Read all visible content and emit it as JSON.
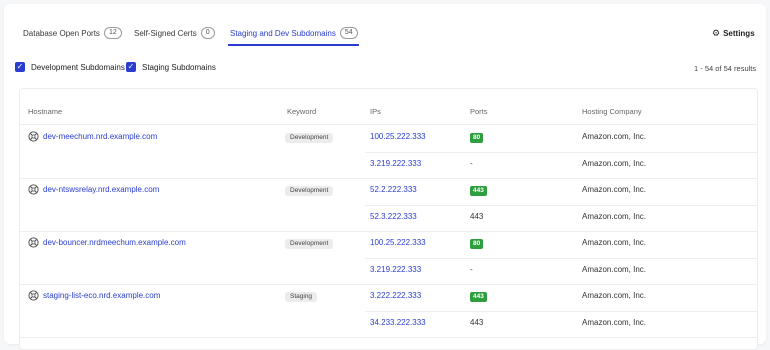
{
  "tabs": [
    {
      "label": "Database Open Ports",
      "count": "12"
    },
    {
      "label": "Self-Signed Certs",
      "count": "0"
    },
    {
      "label": "Staging and Dev Subdomains",
      "count": "54"
    }
  ],
  "settings_label": "Settings",
  "filters": [
    {
      "label": "Development Subdomains",
      "checked": true
    },
    {
      "label": "Staging Subdomains",
      "checked": true
    }
  ],
  "results_text": "1 - 54 of 54 results",
  "table": {
    "headers": [
      "Hostname",
      "Keyword",
      "IPs",
      "Ports",
      "Hosting Company"
    ],
    "rows": [
      {
        "hostname": "dev-meechum.nrd.example.com",
        "keyword": "Development",
        "ip": "100.25.222.333",
        "port": "80",
        "port_badge": true,
        "company": "Amazon.com, Inc."
      },
      {
        "hostname": "",
        "keyword": "",
        "ip": "3.219.222.333",
        "port": "-",
        "port_badge": false,
        "company": "Amazon.com, Inc."
      },
      {
        "hostname": "dev-ntswsrelay.nrd.example.com",
        "keyword": "Development",
        "ip": "52.2.222.333",
        "port": "443",
        "port_badge": true,
        "company": "Amazon.com, Inc."
      },
      {
        "hostname": "",
        "keyword": "",
        "ip": "52.3.222.333",
        "port": "443",
        "port_badge": false,
        "company": "Amazon.com, Inc."
      },
      {
        "hostname": "dev-bouncer.nrdmeechum.example.com",
        "keyword": "Development",
        "ip": "100.25.222.333",
        "port": "80",
        "port_badge": true,
        "company": "Amazon.com, Inc."
      },
      {
        "hostname": "",
        "keyword": "",
        "ip": "3.219.222.333",
        "port": "-",
        "port_badge": false,
        "company": "Amazon.com, Inc."
      },
      {
        "hostname": "staging-list-eco.nrd.example.com",
        "keyword": "Staging",
        "ip": "3.222.222.333",
        "port": "443",
        "port_badge": true,
        "company": "Amazon.com, Inc."
      },
      {
        "hostname": "",
        "keyword": "",
        "ip": "34.233.222.333",
        "port": "443",
        "port_badge": false,
        "company": "Amazon.com, Inc."
      }
    ]
  },
  "colors": {
    "accent": "#2a3dcf",
    "port_badge": "#2e9e3e"
  },
  "icons": {
    "settings": "gear-icon",
    "checkbox": "checkmark-icon",
    "host": "site-favicon-icon"
  }
}
